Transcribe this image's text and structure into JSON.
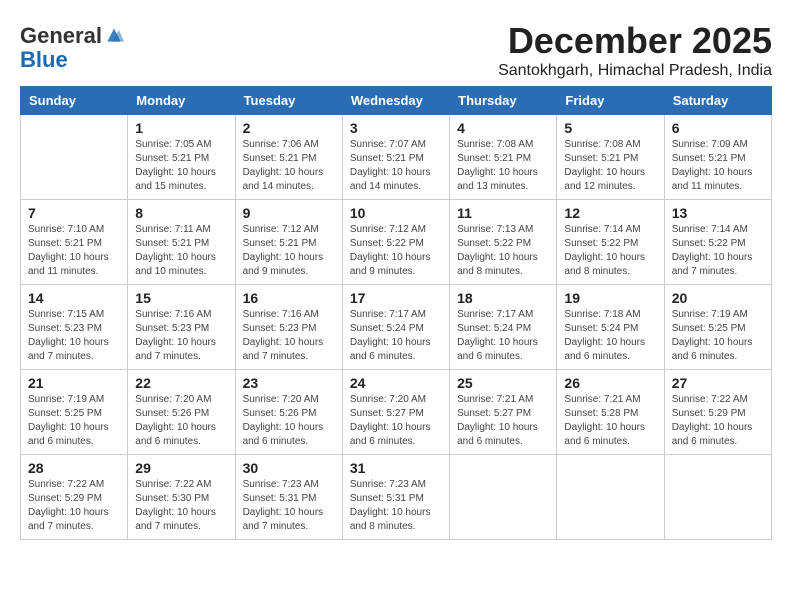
{
  "logo": {
    "general": "General",
    "blue": "Blue"
  },
  "header": {
    "month": "December 2025",
    "location": "Santokhgarh, Himachal Pradesh, India"
  },
  "weekdays": [
    "Sunday",
    "Monday",
    "Tuesday",
    "Wednesday",
    "Thursday",
    "Friday",
    "Saturday"
  ],
  "weeks": [
    [
      {
        "day": "",
        "info": ""
      },
      {
        "day": "1",
        "info": "Sunrise: 7:05 AM\nSunset: 5:21 PM\nDaylight: 10 hours\nand 15 minutes."
      },
      {
        "day": "2",
        "info": "Sunrise: 7:06 AM\nSunset: 5:21 PM\nDaylight: 10 hours\nand 14 minutes."
      },
      {
        "day": "3",
        "info": "Sunrise: 7:07 AM\nSunset: 5:21 PM\nDaylight: 10 hours\nand 14 minutes."
      },
      {
        "day": "4",
        "info": "Sunrise: 7:08 AM\nSunset: 5:21 PM\nDaylight: 10 hours\nand 13 minutes."
      },
      {
        "day": "5",
        "info": "Sunrise: 7:08 AM\nSunset: 5:21 PM\nDaylight: 10 hours\nand 12 minutes."
      },
      {
        "day": "6",
        "info": "Sunrise: 7:09 AM\nSunset: 5:21 PM\nDaylight: 10 hours\nand 11 minutes."
      }
    ],
    [
      {
        "day": "7",
        "info": "Sunrise: 7:10 AM\nSunset: 5:21 PM\nDaylight: 10 hours\nand 11 minutes."
      },
      {
        "day": "8",
        "info": "Sunrise: 7:11 AM\nSunset: 5:21 PM\nDaylight: 10 hours\nand 10 minutes."
      },
      {
        "day": "9",
        "info": "Sunrise: 7:12 AM\nSunset: 5:21 PM\nDaylight: 10 hours\nand 9 minutes."
      },
      {
        "day": "10",
        "info": "Sunrise: 7:12 AM\nSunset: 5:22 PM\nDaylight: 10 hours\nand 9 minutes."
      },
      {
        "day": "11",
        "info": "Sunrise: 7:13 AM\nSunset: 5:22 PM\nDaylight: 10 hours\nand 8 minutes."
      },
      {
        "day": "12",
        "info": "Sunrise: 7:14 AM\nSunset: 5:22 PM\nDaylight: 10 hours\nand 8 minutes."
      },
      {
        "day": "13",
        "info": "Sunrise: 7:14 AM\nSunset: 5:22 PM\nDaylight: 10 hours\nand 7 minutes."
      }
    ],
    [
      {
        "day": "14",
        "info": "Sunrise: 7:15 AM\nSunset: 5:23 PM\nDaylight: 10 hours\nand 7 minutes."
      },
      {
        "day": "15",
        "info": "Sunrise: 7:16 AM\nSunset: 5:23 PM\nDaylight: 10 hours\nand 7 minutes."
      },
      {
        "day": "16",
        "info": "Sunrise: 7:16 AM\nSunset: 5:23 PM\nDaylight: 10 hours\nand 7 minutes."
      },
      {
        "day": "17",
        "info": "Sunrise: 7:17 AM\nSunset: 5:24 PM\nDaylight: 10 hours\nand 6 minutes."
      },
      {
        "day": "18",
        "info": "Sunrise: 7:17 AM\nSunset: 5:24 PM\nDaylight: 10 hours\nand 6 minutes."
      },
      {
        "day": "19",
        "info": "Sunrise: 7:18 AM\nSunset: 5:24 PM\nDaylight: 10 hours\nand 6 minutes."
      },
      {
        "day": "20",
        "info": "Sunrise: 7:19 AM\nSunset: 5:25 PM\nDaylight: 10 hours\nand 6 minutes."
      }
    ],
    [
      {
        "day": "21",
        "info": "Sunrise: 7:19 AM\nSunset: 5:25 PM\nDaylight: 10 hours\nand 6 minutes."
      },
      {
        "day": "22",
        "info": "Sunrise: 7:20 AM\nSunset: 5:26 PM\nDaylight: 10 hours\nand 6 minutes."
      },
      {
        "day": "23",
        "info": "Sunrise: 7:20 AM\nSunset: 5:26 PM\nDaylight: 10 hours\nand 6 minutes."
      },
      {
        "day": "24",
        "info": "Sunrise: 7:20 AM\nSunset: 5:27 PM\nDaylight: 10 hours\nand 6 minutes."
      },
      {
        "day": "25",
        "info": "Sunrise: 7:21 AM\nSunset: 5:27 PM\nDaylight: 10 hours\nand 6 minutes."
      },
      {
        "day": "26",
        "info": "Sunrise: 7:21 AM\nSunset: 5:28 PM\nDaylight: 10 hours\nand 6 minutes."
      },
      {
        "day": "27",
        "info": "Sunrise: 7:22 AM\nSunset: 5:29 PM\nDaylight: 10 hours\nand 6 minutes."
      }
    ],
    [
      {
        "day": "28",
        "info": "Sunrise: 7:22 AM\nSunset: 5:29 PM\nDaylight: 10 hours\nand 7 minutes."
      },
      {
        "day": "29",
        "info": "Sunrise: 7:22 AM\nSunset: 5:30 PM\nDaylight: 10 hours\nand 7 minutes."
      },
      {
        "day": "30",
        "info": "Sunrise: 7:23 AM\nSunset: 5:31 PM\nDaylight: 10 hours\nand 7 minutes."
      },
      {
        "day": "31",
        "info": "Sunrise: 7:23 AM\nSunset: 5:31 PM\nDaylight: 10 hours\nand 8 minutes."
      },
      {
        "day": "",
        "info": ""
      },
      {
        "day": "",
        "info": ""
      },
      {
        "day": "",
        "info": ""
      }
    ]
  ]
}
